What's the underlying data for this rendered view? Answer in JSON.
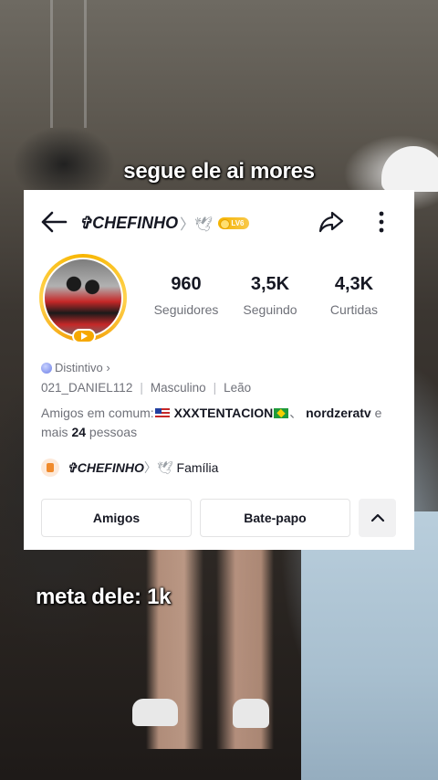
{
  "captions": {
    "top": "segue ele ai mores",
    "bottom": "meta dele: 1k"
  },
  "profile": {
    "name": "✞CHEFINHO",
    "name_deco": "〉🕊",
    "level_badge": "LV6",
    "stats": [
      {
        "value": "960",
        "label": "Seguidores"
      },
      {
        "value": "3,5K",
        "label": "Seguindo"
      },
      {
        "value": "4,3K",
        "label": "Curtidas"
      }
    ],
    "badge_link": "Distintivo ›",
    "username": "021_DANIEL112",
    "gender": "Masculino",
    "sign": "Leão",
    "mutual": {
      "prefix": "Amigos em comum:",
      "friend1": "XXXTENTACION",
      "friend2": "nordzeratv",
      "conj": "e",
      "more_prefix": "mais",
      "more_count": "24",
      "more_suffix": "pessoas"
    },
    "family": {
      "name": "✞CHEFINHO",
      "deco": "〉🕊",
      "label": "Família"
    }
  },
  "buttons": {
    "friends": "Amigos",
    "chat": "Bate-papo"
  },
  "icons": {
    "back": "back-arrow-icon",
    "share": "share-icon",
    "more": "more-vertical-icon",
    "expand": "chevron-up-icon"
  },
  "colors": {
    "badge_gold": "#f5b400",
    "text_primary": "#161823",
    "text_secondary": "#6f7179"
  }
}
